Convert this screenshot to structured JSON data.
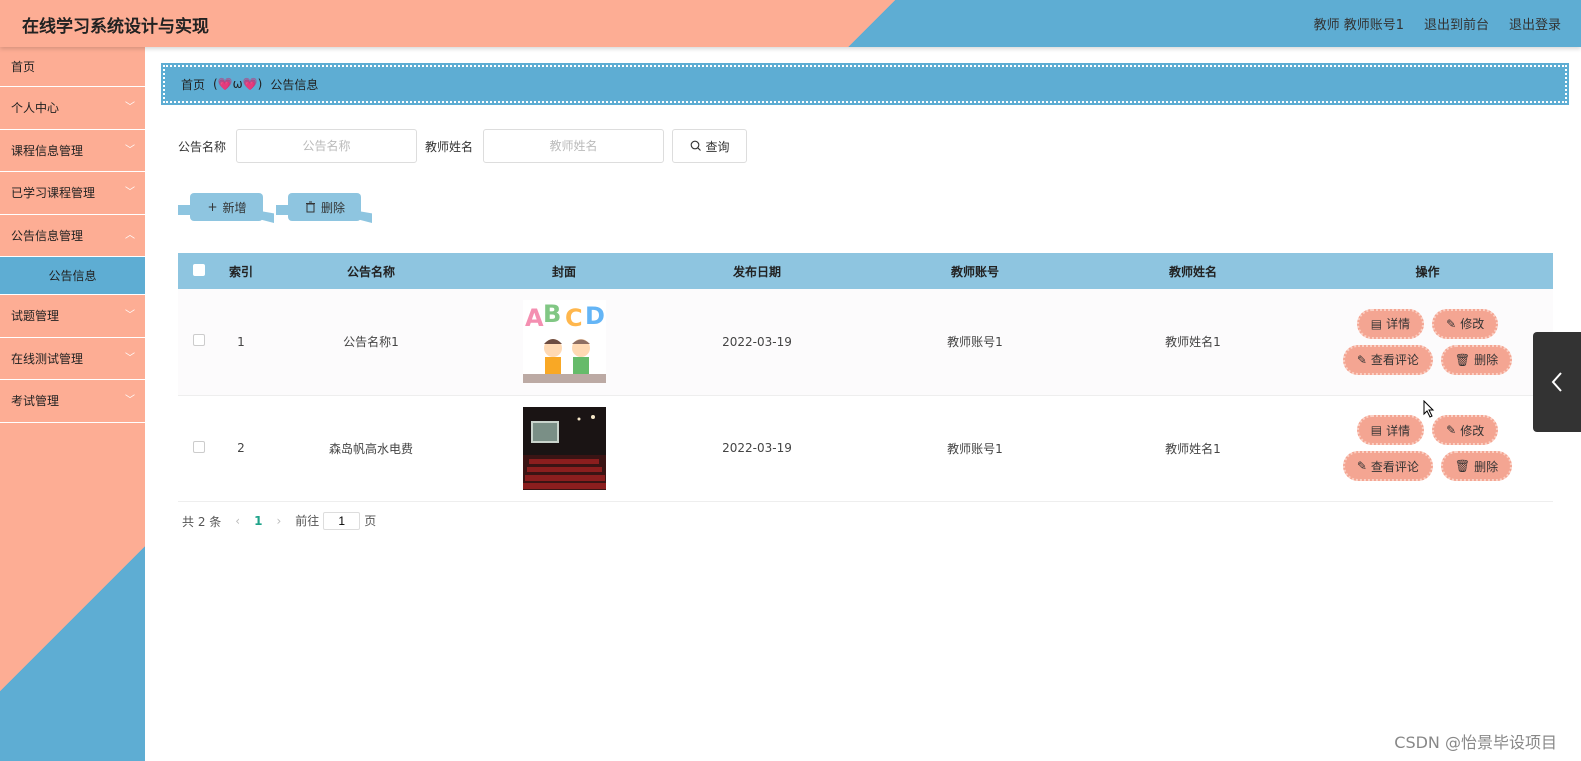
{
  "header": {
    "title": "在线学习系统设计与实现",
    "user": "教师 教师账号1",
    "front_link": "退出到前台",
    "logout_link": "退出登录",
    "colors": {
      "salmon": "#fdad94",
      "blue": "#5eadd3"
    }
  },
  "sidebar": {
    "items": [
      {
        "label": "首页"
      },
      {
        "label": "个人中心"
      },
      {
        "label": "课程信息管理"
      },
      {
        "label": "已学习课程管理"
      },
      {
        "label": "公告信息管理"
      },
      {
        "label": "公告信息"
      },
      {
        "label": "试题管理"
      },
      {
        "label": "在线测试管理"
      },
      {
        "label": "考试管理"
      }
    ]
  },
  "breadcrumb": {
    "home": "首页",
    "separator": "(💗ω💗)",
    "current": "公告信息"
  },
  "search": {
    "field1_label": "公告名称",
    "field1_placeholder": "公告名称",
    "field2_label": "教师姓名",
    "field2_placeholder": "教师姓名",
    "query_label": "查询"
  },
  "actions": {
    "add_label": "新增",
    "delete_label": "删除"
  },
  "table": {
    "headers": [
      "索引",
      "公告名称",
      "封面",
      "发布日期",
      "教师账号",
      "教师姓名",
      "操作"
    ],
    "rows": [
      {
        "index": "1",
        "name": "公告名称1",
        "cover": "abcd-kids-image",
        "date": "2022-03-19",
        "account": "教师账号1",
        "teacher": "教师姓名1"
      },
      {
        "index": "2",
        "name": "森岛帆高水电费",
        "cover": "cinema-image",
        "date": "2022-03-19",
        "account": "教师账号1",
        "teacher": "教师姓名1"
      }
    ],
    "op_labels": {
      "detail": "详情",
      "edit": "修改",
      "comments": "查看评论",
      "delete": "删除"
    }
  },
  "pager": {
    "total": "共 2 条",
    "current_page": "1",
    "goto_label": "前往",
    "goto_value": "1",
    "page_suffix": "页"
  },
  "watermark": "CSDN @怡景毕设项目"
}
